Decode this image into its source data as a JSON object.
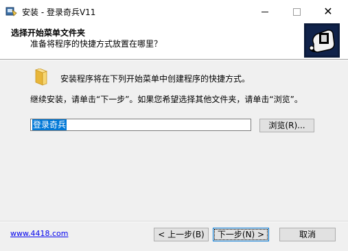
{
  "window": {
    "title": "安装 - 登录奇兵V11",
    "minimize_symbol": "",
    "close_symbol": "✕"
  },
  "header": {
    "title": "选择开始菜单文件夹",
    "subtitle": "准备将程序的快捷方式放置在哪里？"
  },
  "content": {
    "folder_text": "安装程序将在下列开始菜单中创建程序的快捷方式。",
    "continue_text": "继续安装，请单击“下一步”。如果您希望选择其他文件夹，请单击“浏览”。",
    "path_value": "登录奇兵",
    "browse_label": "浏览(R)..."
  },
  "footer": {
    "link_text": "www.4418.com",
    "back_label": "< 上一步(B)",
    "next_label": "下一步(N) >",
    "cancel_label": "取消"
  },
  "colors": {
    "selection": "#0078d7",
    "link": "#0000ee",
    "background": "#f0f0f0"
  },
  "icons": [
    "installer-app-icon",
    "minimize-icon",
    "maximize-icon",
    "close-icon",
    "installer-logo-icon",
    "folder-icon"
  ]
}
